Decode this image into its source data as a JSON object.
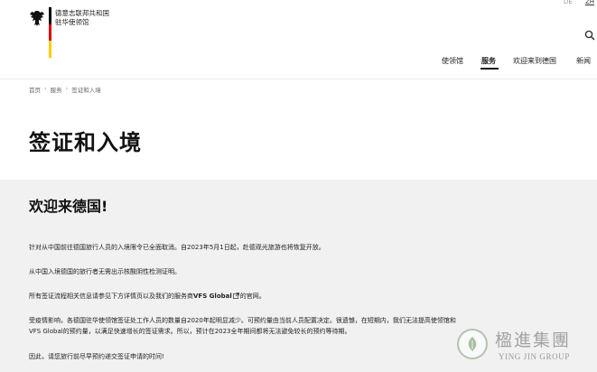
{
  "header": {
    "site_name_line1": "德意志联邦共和国",
    "site_name_line2": "驻华使领馆",
    "lang_de": "DE",
    "lang_zh": "ZH"
  },
  "nav": {
    "items": [
      {
        "label": "使领馆"
      },
      {
        "label": "服务"
      },
      {
        "label": "欢迎来到德国"
      },
      {
        "label": "新闻"
      }
    ],
    "active": "服务"
  },
  "breadcrumb": {
    "items": [
      "首页",
      "服务",
      "签证和入境"
    ],
    "separator": "›"
  },
  "page": {
    "title": "签证和入境"
  },
  "content": {
    "heading": "欢迎来德国!",
    "p1": "针对从中国前往德国旅行人员的入境限令已全面取消。自2023年5月1日起，赴德观光旅游也将恢复开放。",
    "p2": "从中国入境德国的旅行者无需出示核酸阴性检测证明。",
    "p3_before": "所有签证流程相关信息请参见下方详情页以及我们的服务商",
    "p3_link": "VFS Global",
    "p3_after": "的官网。",
    "p4_line1": "受疫情影响，各德国驻华使领馆签证处工作人员的数量自2020年起明显减少。可预约量由当前人员配置决定。很遗憾，在短期内，我们无法提高使领馆和",
    "p4_line2": "VFS Global的预约量，以满足快速增长的签证需求。所以，预计在2023全年期间都将无法避免较长的预约等待期。",
    "p5": "因此，请您旅行前尽早预约递交签证申请的时间!"
  },
  "watermark": {
    "cn": "楹進集團",
    "en": "YING JIN GROUP"
  },
  "colors": {
    "flag_black": "#000000",
    "flag_red": "#dd0000",
    "flag_gold": "#ffcc00",
    "panel_bg": "#f1f1f1"
  }
}
